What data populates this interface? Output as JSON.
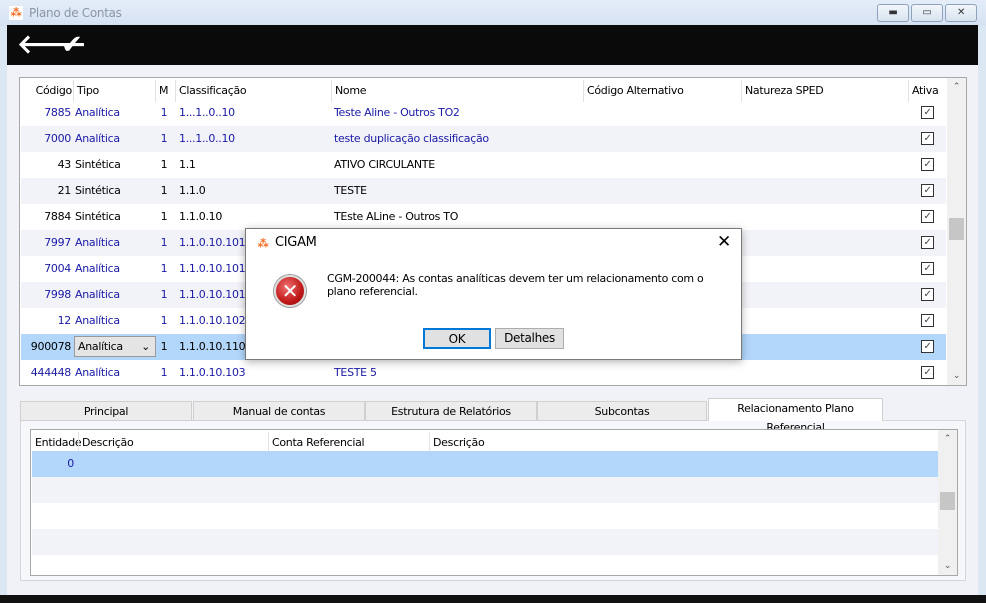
{
  "window": {
    "title": "Plano de Contas",
    "icon": "cigam-logo-icon",
    "controls": [
      "minimize",
      "maximize",
      "close"
    ]
  },
  "toolbar": {
    "back_icon": "arrow-left-icon",
    "confirm_icon": "checkmark-icon"
  },
  "grid": {
    "columns": [
      "Código",
      "Tipo",
      "M",
      "Classificação",
      "Nome",
      "Código Alternativo",
      "Natureza SPED",
      "Ativa"
    ],
    "rows": [
      {
        "codigo": "7885",
        "tipo": "Analítica",
        "m": "1",
        "classificacao": "1...1..0..10",
        "nome": "Teste Aline - Outros TO2",
        "ativa": true,
        "blue": true
      },
      {
        "codigo": "7000",
        "tipo": "Analítica",
        "m": "1",
        "classificacao": "1...1..0..10",
        "nome": "teste duplicação classificação",
        "ativa": true,
        "blue": true
      },
      {
        "codigo": "43",
        "tipo": "Sintética",
        "m": "1",
        "classificacao": "1.1",
        "nome": "ATIVO CIRCULANTE",
        "ativa": true,
        "blue": false
      },
      {
        "codigo": "21",
        "tipo": "Sintética",
        "m": "1",
        "classificacao": "1.1.0",
        "nome": "TESTE",
        "ativa": true,
        "blue": false
      },
      {
        "codigo": "7884",
        "tipo": "Sintética",
        "m": "1",
        "classificacao": "1.1.0.10",
        "nome": "TEste ALine - Outros TO",
        "ativa": true,
        "blue": false
      },
      {
        "codigo": "7997",
        "tipo": "Analítica",
        "m": "1",
        "classificacao": "1.1.0.10.101",
        "nome": "",
        "ativa": true,
        "blue": true
      },
      {
        "codigo": "7004",
        "tipo": "Analítica",
        "m": "1",
        "classificacao": "1.1.0.10.101",
        "nome": "",
        "ativa": true,
        "blue": true
      },
      {
        "codigo": "7998",
        "tipo": "Analítica",
        "m": "1",
        "classificacao": "1.1.0.10.101",
        "nome": "",
        "ativa": true,
        "blue": true
      },
      {
        "codigo": "12",
        "tipo": "Analítica",
        "m": "1",
        "classificacao": "1.1.0.10.102",
        "nome": "",
        "ativa": true,
        "blue": true
      },
      {
        "codigo": "900078",
        "tipo": "Analítica",
        "m": "1",
        "classificacao": "1.1.0.10.110",
        "nome": "",
        "ativa": true,
        "blue": false,
        "selected": true
      },
      {
        "codigo": "444448",
        "tipo": "Analítica",
        "m": "1",
        "classificacao": "1.1.0.10.103",
        "nome": "TESTE 5",
        "ativa": true,
        "blue": true
      }
    ]
  },
  "tabs": [
    {
      "label": "Principal"
    },
    {
      "label": "Manual de contas"
    },
    {
      "label": "Estrutura de Relatórios"
    },
    {
      "label": "Subcontas"
    },
    {
      "label": "Relacionamento Plano Referencial",
      "active": true
    }
  ],
  "subgrid": {
    "columns": [
      "Entidade",
      "Descrição",
      "Conta Referencial",
      "Descrição"
    ],
    "rows": [
      {
        "entidade": "0"
      }
    ]
  },
  "dialog": {
    "title": "CIGAM",
    "icon": "error-icon",
    "message": "CGM-200044: As contas analíticas devem ter um relacionamento com o plano referencial.",
    "ok_label": "OK",
    "details_label": "Detalhes"
  },
  "colors": {
    "selected_row": "#b3d7fb",
    "link_blue": "#1a1aa6",
    "toolbar": "#0a0a0a"
  }
}
